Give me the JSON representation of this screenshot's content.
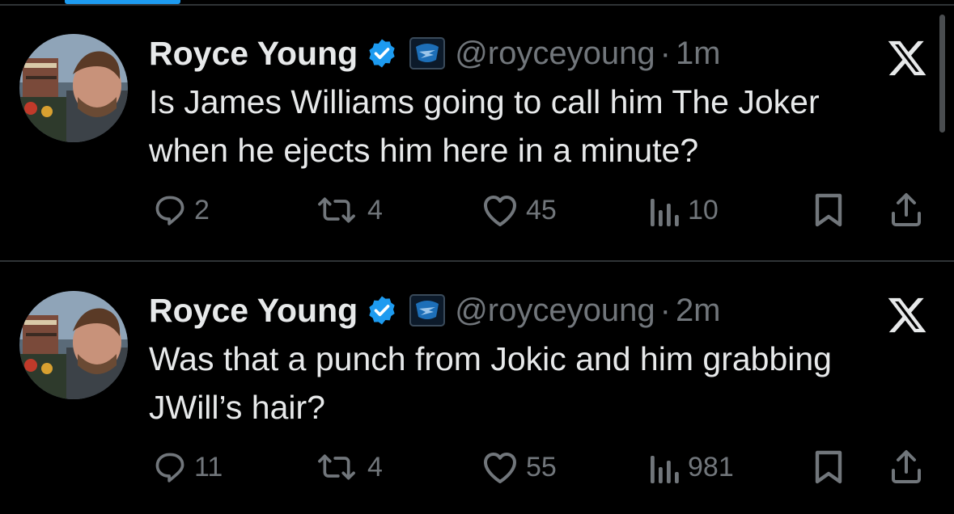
{
  "colors": {
    "background": "#000000",
    "text_primary": "#e7e9ea",
    "text_secondary": "#71767b",
    "verified_blue": "#1d9bf0",
    "divider": "#2f3336"
  },
  "tweets": [
    {
      "author": {
        "name": "Royce Young",
        "handle": "@royceyoung",
        "verified_icon": "verified-badge-icon",
        "affiliation_icon": "thunder-team-logo-icon"
      },
      "separator": "·",
      "time": "1m",
      "text": "Is James Williams going to call him The Joker\nwhen he ejects him here in a minute?",
      "stats": {
        "replies": "2",
        "reposts": "4",
        "likes": "45",
        "views": "10"
      }
    },
    {
      "author": {
        "name": "Royce Young",
        "handle": "@royceyoung",
        "verified_icon": "verified-badge-icon",
        "affiliation_icon": "thunder-team-logo-icon"
      },
      "separator": "·",
      "time": "2m",
      "text": "Was that a punch from Jokic and him grabbing\nJWill’s hair?",
      "stats": {
        "replies": "11",
        "reposts": "4",
        "likes": "55",
        "views": "981"
      }
    }
  ]
}
